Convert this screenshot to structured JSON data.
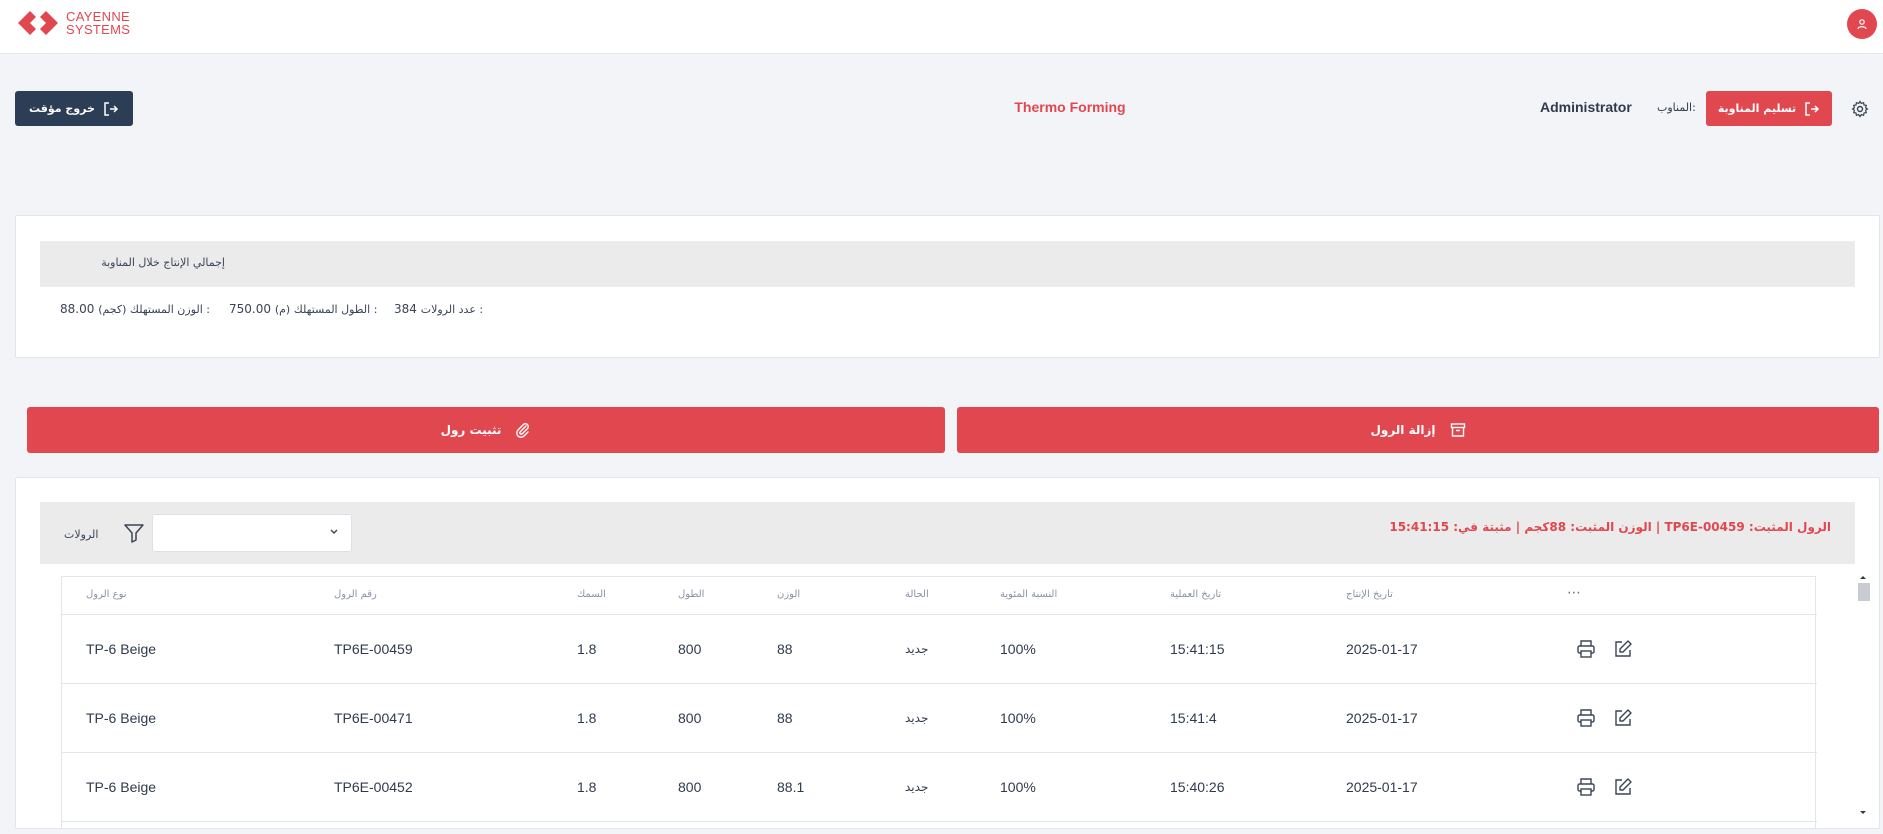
{
  "brand": {
    "line1": "CAYENNE",
    "line2": "SYSTEMS",
    "color": "#e1474f"
  },
  "header": {
    "temp_exit_label": "خروج مؤقت",
    "app_title": "Thermo Forming",
    "shift_user": "Administrator",
    "shift_label": "المناوب:",
    "handover_label": "تسليم المناوبة"
  },
  "summary": {
    "title": "إجمالي الإنتاج خلال المناوبة",
    "rolls_count_label": "عدد الرولات :",
    "rolls_count_value": "384",
    "length_label": "الطول المستهلك (م) :",
    "length_value": "750.00",
    "weight_label": "الوزن المستهلك (كجم) :",
    "weight_value": "88.00"
  },
  "actions": {
    "install_roll": "تثبيت رول",
    "remove_roll": "إزالة الرول"
  },
  "rolls": {
    "title": "الرولات",
    "select_value": "",
    "fixed_info": "الرول المثبت: TP6E-00459 | الوزن المثبت: 88كجم | مثبتة في: 15:41:15",
    "columns": {
      "roll_type": "نوع الرول",
      "roll_number": "رقم الرول",
      "thickness": "السمك",
      "length": "الطول",
      "weight": "الوزن",
      "status": "الحالة",
      "percent": "النسبة المئوية",
      "op_date": "تاريخ العملية",
      "prod_date": "تاريخ الإنتاج",
      "more": "⋯"
    },
    "rows": [
      {
        "roll_type": "TP-6 Beige",
        "roll_number": "TP6E-00459",
        "thickness": "1.8",
        "length": "800",
        "weight": "88",
        "status": "جديد",
        "percent": "100%",
        "op_date": "15:41:15",
        "prod_date": "2025-01-17"
      },
      {
        "roll_type": "TP-6 Beige",
        "roll_number": "TP6E-00471",
        "thickness": "1.8",
        "length": "800",
        "weight": "88",
        "status": "جديد",
        "percent": "100%",
        "op_date": "15:41:4",
        "prod_date": "2025-01-17"
      },
      {
        "roll_type": "TP-6 Beige",
        "roll_number": "TP6E-00452",
        "thickness": "1.8",
        "length": "800",
        "weight": "88.1",
        "status": "جديد",
        "percent": "100%",
        "op_date": "15:40:26",
        "prod_date": "2025-01-17"
      }
    ]
  }
}
